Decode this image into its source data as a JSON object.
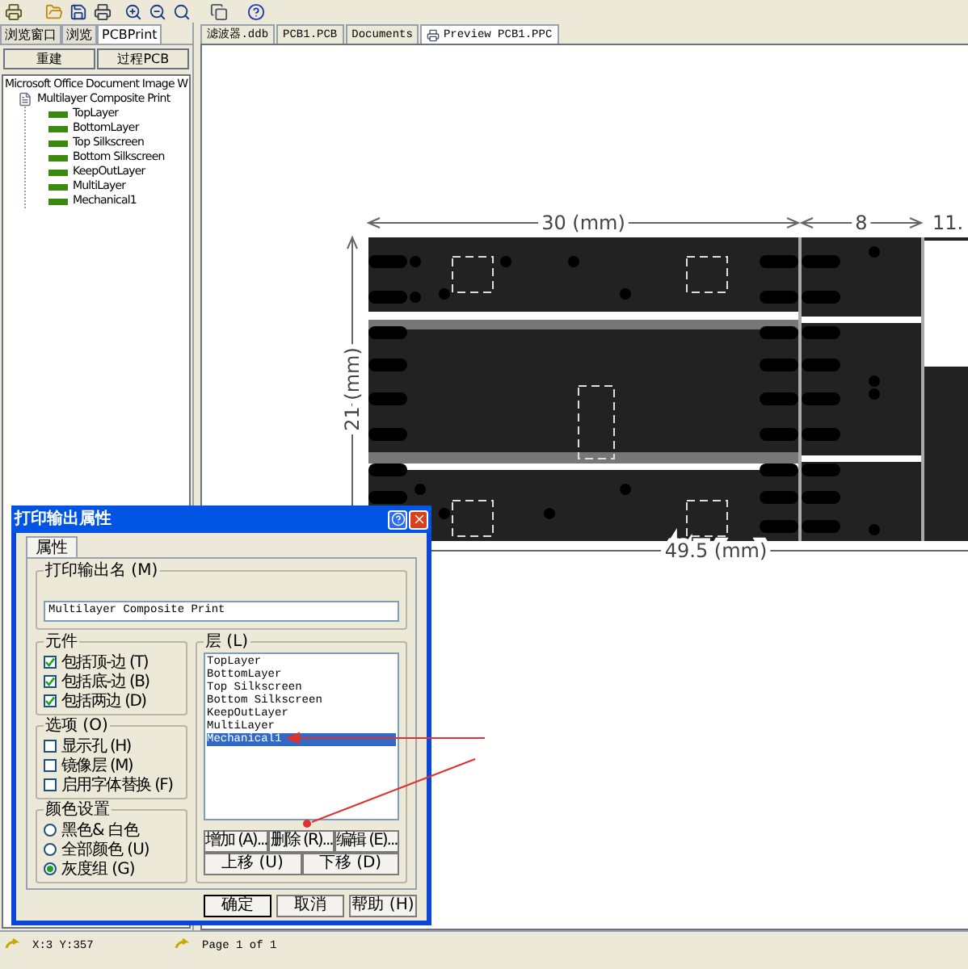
{
  "left_panel": {
    "tabs": [
      {
        "label": "浏览窗口",
        "selected": false
      },
      {
        "label": "浏览",
        "selected": false
      },
      {
        "label": "PCBPrint",
        "selected": true
      }
    ],
    "buttons": [
      "重建",
      "过程PCB"
    ],
    "tree": [
      {
        "label": "Microsoft Office Document Image W",
        "children": [
          {
            "label": "Multilayer Composite Print",
            "kind": "document",
            "children": [
              {
                "label": "TopLayer",
                "kind": "layer"
              },
              {
                "label": "BottomLayer",
                "kind": "layer"
              },
              {
                "label": "Top Silkscreen",
                "kind": "layer"
              },
              {
                "label": "Bottom Silkscreen",
                "kind": "layer"
              },
              {
                "label": "KeepOutLayer",
                "kind": "layer"
              },
              {
                "label": "MultiLayer",
                "kind": "layer"
              },
              {
                "label": "Mechanical1",
                "kind": "layer"
              }
            ]
          }
        ]
      }
    ]
  },
  "document_tabs": [
    {
      "label": "滤波器.ddb",
      "kind": "file",
      "selected": false
    },
    {
      "label": "PCB1.PCB",
      "kind": "file",
      "selected": false
    },
    {
      "label": "Documents",
      "kind": "file",
      "selected": false
    },
    {
      "label": "Preview PCB1.PPC",
      "kind": "preview",
      "selected": true
    }
  ],
  "preview": {
    "top_dimensions": [
      "30 (mm)",
      "8",
      "11."
    ],
    "side_dimension": "21 (mm)",
    "bottom_dimension": "49.5 (mm)"
  },
  "dialog": {
    "title": "打印输出属性",
    "tab": "属性",
    "name_group": "打印输出名 (M)",
    "name_value": "Multilayer Composite Print",
    "components": {
      "title": "元件",
      "items": [
        {
          "label": "包括顶-边 (T)",
          "checked": true
        },
        {
          "label": "包括底-边 (B)",
          "checked": true
        },
        {
          "label": "包括两边 (D)",
          "checked": true
        }
      ]
    },
    "options": {
      "title": "选项 (O)",
      "items": [
        {
          "label": "显示孔 (H)",
          "checked": false
        },
        {
          "label": "镜像层 (M)",
          "checked": false
        },
        {
          "label": "启用字体替换 (F)",
          "checked": false
        }
      ]
    },
    "colors": {
      "title": "颜色设置",
      "items": [
        {
          "label": "黑色& 白色",
          "selected": false
        },
        {
          "label": "全部颜色 (U)",
          "selected": false
        },
        {
          "label": "灰度组 (G)",
          "selected": true
        }
      ]
    },
    "layers": {
      "title": "层 (L)",
      "items": [
        {
          "label": "TopLayer",
          "selected": false
        },
        {
          "label": "BottomLayer",
          "selected": false
        },
        {
          "label": "Top Silkscreen",
          "selected": false
        },
        {
          "label": "Bottom Silkscreen",
          "selected": false
        },
        {
          "label": "KeepOutLayer",
          "selected": false
        },
        {
          "label": "MultiLayer",
          "selected": false
        },
        {
          "label": "Mechanical1",
          "selected": true
        }
      ]
    },
    "layer_buttons": [
      "增加 (A)...",
      "删除 (R)...",
      "编辑 (E)..."
    ],
    "move_buttons": [
      "上移 (U)",
      "下移 (D)"
    ],
    "footer_buttons": [
      "确定",
      "取消",
      "帮助 (H)"
    ]
  },
  "status_bar": {
    "position": "X:3 Y:357",
    "page": "Page 1 of 1"
  }
}
